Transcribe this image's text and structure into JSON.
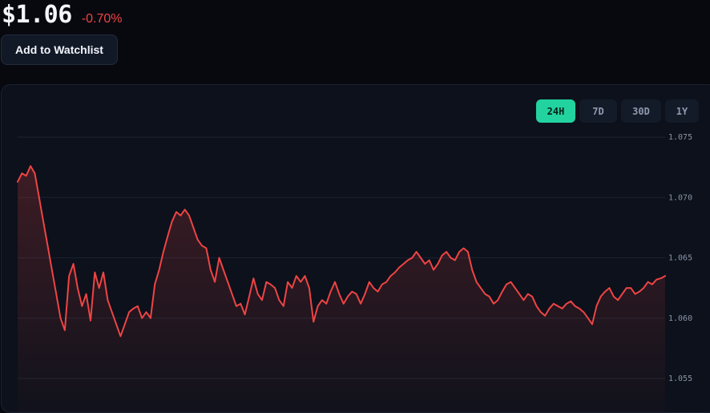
{
  "header": {
    "price": "$1.06",
    "change": "-0.70%"
  },
  "actions": {
    "watchlist_label": "Add to Watchlist"
  },
  "range_tabs": [
    {
      "label": "24H",
      "active": true
    },
    {
      "label": "7D",
      "active": false
    },
    {
      "label": "30D",
      "active": false
    },
    {
      "label": "1Y",
      "active": false
    }
  ],
  "colors": {
    "line": "#ef4444",
    "active_tab": "#22d3a0"
  },
  "chart_data": {
    "type": "area",
    "ylim": [
      1.055,
      1.075
    ],
    "yticks": [
      "1.075",
      "1.070",
      "1.065",
      "1.060",
      "1.055"
    ],
    "xlabel": "",
    "ylabel": "",
    "grid": true,
    "series": [
      {
        "values": [
          1.0713,
          1.072,
          1.0718,
          1.0726,
          1.072,
          1.07,
          1.068,
          1.066,
          1.064,
          1.062,
          1.06,
          1.059,
          1.0635,
          1.0645,
          1.0625,
          1.061,
          1.062,
          1.0598,
          1.0638,
          1.0625,
          1.0638,
          1.0615,
          1.0605,
          1.0595,
          1.0585,
          1.0595,
          1.0605,
          1.0608,
          1.061,
          1.06,
          1.0605,
          1.06,
          1.0628,
          1.064,
          1.0655,
          1.0668,
          1.068,
          1.0688,
          1.0685,
          1.069,
          1.0685,
          1.0675,
          1.0665,
          1.066,
          1.0658,
          1.064,
          1.063,
          1.065,
          1.064,
          1.063,
          1.062,
          1.061,
          1.0612,
          1.0603,
          1.0618,
          1.0633,
          1.062,
          1.0615,
          1.063,
          1.0628,
          1.0625,
          1.0615,
          1.061,
          1.063,
          1.0625,
          1.0635,
          1.063,
          1.0635,
          1.0625,
          1.0597,
          1.061,
          1.0615,
          1.0612,
          1.0622,
          1.063,
          1.062,
          1.0612,
          1.0618,
          1.0622,
          1.062,
          1.0612,
          1.062,
          1.063,
          1.0625,
          1.0622,
          1.0628,
          1.063,
          1.0635,
          1.0638,
          1.0642,
          1.0645,
          1.0648,
          1.065,
          1.0655,
          1.065,
          1.0645,
          1.0648,
          1.064,
          1.0645,
          1.0652,
          1.0655,
          1.065,
          1.0648,
          1.0655,
          1.0658,
          1.0655,
          1.064,
          1.063,
          1.0625,
          1.062,
          1.0618,
          1.0612,
          1.0615,
          1.0622,
          1.0628,
          1.063,
          1.0625,
          1.062,
          1.0615,
          1.062,
          1.0618,
          1.061,
          1.0605,
          1.0602,
          1.0608,
          1.0612,
          1.061,
          1.0608,
          1.0612,
          1.0614,
          1.061,
          1.0608,
          1.0605,
          1.06,
          1.0595,
          1.061,
          1.0618,
          1.0622,
          1.0625,
          1.0618,
          1.0615,
          1.062,
          1.0625,
          1.0625,
          1.062,
          1.0622,
          1.0625,
          1.063,
          1.0628,
          1.0632,
          1.0633,
          1.0635
        ]
      }
    ]
  }
}
